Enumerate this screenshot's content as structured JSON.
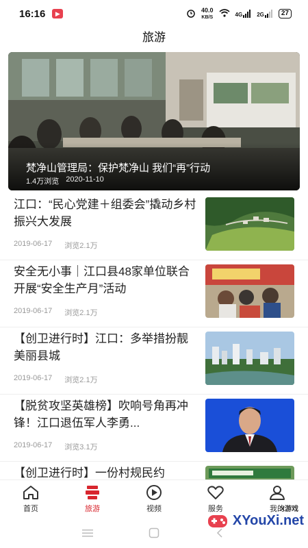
{
  "status_bar": {
    "time": "16:16",
    "app_badge": "▶",
    "net_speed_value": "40.0",
    "net_speed_unit": "KB/S",
    "signal_1": "4G",
    "signal_2": "2G",
    "battery": "27"
  },
  "header": {
    "title": "旅游"
  },
  "hero": {
    "title": "梵净山管理局：保护梵净山 我们“再”行动",
    "views": "1.4万浏览",
    "date": "2020-11-10"
  },
  "news": [
    {
      "title": "江口：“民心党建＋组委会”撬动乡村振兴大发展",
      "date": "2019-06-17",
      "views": "浏览2.1万",
      "thumb": "village-aerial"
    },
    {
      "title": "安全无小事｜江口县48家单位联合开展“安全生产月”活动",
      "date": "2019-06-17",
      "views": "浏览2.1万",
      "thumb": "safety-event"
    },
    {
      "title": "【创卫进行时】江口：多举措扮靓美丽县城",
      "date": "2019-06-17",
      "views": "浏览2.1万",
      "thumb": "city-river"
    },
    {
      "title": "【脱贫攻坚英雄榜】吹响号角再冲锋！江口退伍军人李勇...",
      "date": "2019-06-17",
      "views": "浏览3.1万",
      "thumb": "portrait"
    },
    {
      "title": "【创卫进行时】一份村规民约",
      "date": "",
      "views": "",
      "thumb": "village-sign"
    }
  ],
  "tabs": [
    {
      "label": "首页",
      "icon": "home-icon",
      "active": false
    },
    {
      "label": "旅游",
      "icon": "travel-icon",
      "active": true
    },
    {
      "label": "视频",
      "icon": "play-icon",
      "active": false
    },
    {
      "label": "服务",
      "icon": "heart-icon",
      "active": false
    },
    {
      "label": "我的",
      "icon": "user-icon",
      "active": false
    }
  ],
  "watermark": {
    "brand": "XYouXi.net",
    "sub": "X游戏"
  },
  "colors": {
    "accent": "#d8262e",
    "text": "#222222",
    "meta": "#999999"
  }
}
